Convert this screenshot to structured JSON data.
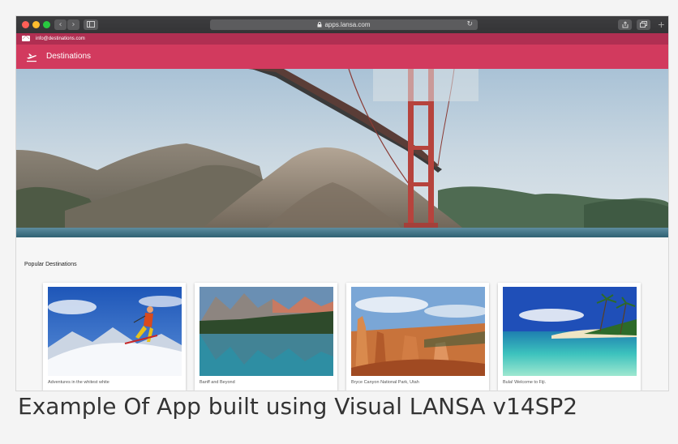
{
  "browser": {
    "url": "apps.lansa.com",
    "back_glyph": "‹",
    "forward_glyph": "›",
    "reload_glyph": "↻",
    "new_tab_glyph": "+",
    "icons": [
      "sidebar-icon",
      "lock-icon",
      "reload-icon",
      "share-icon",
      "tabs-icon"
    ]
  },
  "header": {
    "email": "info@destinations.com",
    "app_title": "Destinations",
    "brand_color": "#d23a5e",
    "contact_bar_color": "#b02f52"
  },
  "content": {
    "section_title": "Popular Destinations",
    "cards": [
      {
        "label": "Adventures in the whitest white"
      },
      {
        "label": "Banff and Beyond"
      },
      {
        "label": "Bryce Canyon National Park, Utah"
      },
      {
        "label": "Bula! Welcome to Fiji."
      }
    ]
  },
  "caption": "Example Of App built using Visual LANSA v14SP2"
}
